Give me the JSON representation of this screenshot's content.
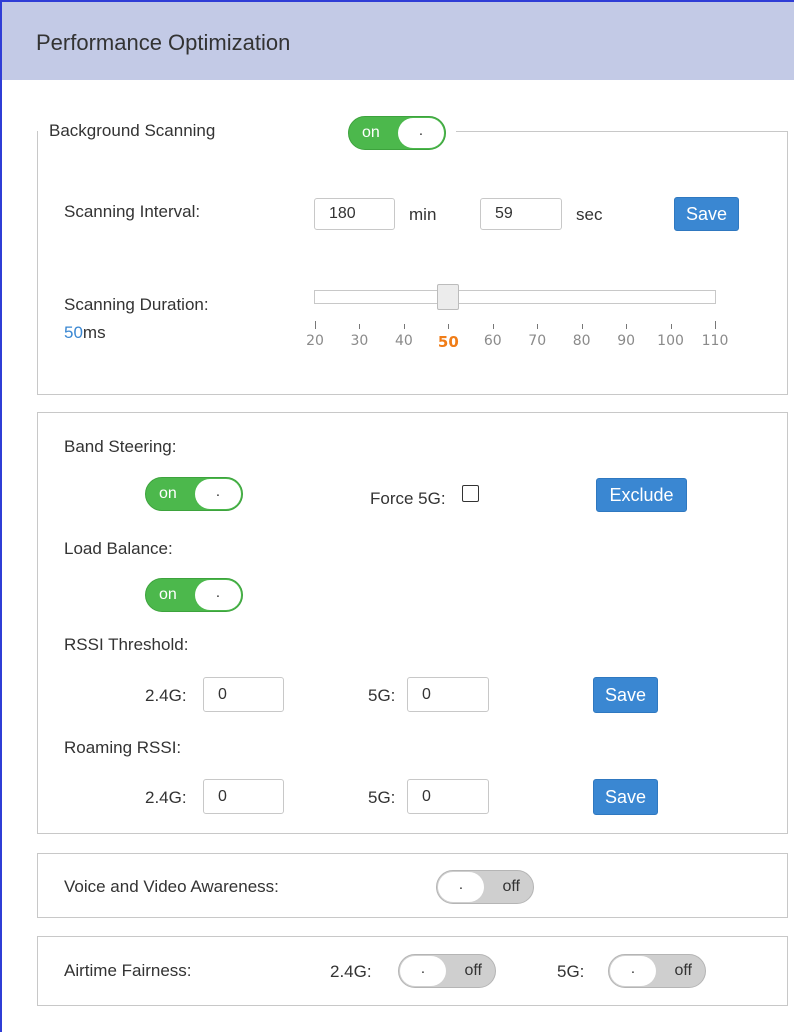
{
  "header": {
    "title": "Performance Optimization"
  },
  "background_scanning": {
    "title": "Background Scanning",
    "toggle": {
      "state_label": "on",
      "knob_label": "."
    },
    "interval_label": "Scanning Interval:",
    "interval_min_value": "180",
    "interval_min_unit": "min",
    "interval_sec_value": "59",
    "interval_sec_unit": "sec",
    "save_label": "Save",
    "duration_label": "Scanning Duration:",
    "duration_value": "50",
    "duration_unit": "ms",
    "slider": {
      "ticks": [
        "20",
        "30",
        "40",
        "50",
        "60",
        "70",
        "80",
        "90",
        "100",
        "110"
      ],
      "min": 20,
      "max": 110,
      "value": 50
    }
  },
  "band_steering": {
    "label": "Band Steering:",
    "toggle": {
      "state_label": "on",
      "knob_label": "."
    },
    "force5g_label": "Force 5G:",
    "force5g_checked": false,
    "exclude_label": "Exclude",
    "load_balance_label": "Load Balance:",
    "load_balance_toggle": {
      "state_label": "on",
      "knob_label": "."
    },
    "rssi_threshold_label": "RSSI Threshold:",
    "rssi_24g_label": "2.4G:",
    "rssi_24g_value": "0",
    "rssi_5g_label": "5G:",
    "rssi_5g_value": "0",
    "rssi_save_label": "Save",
    "roaming_rssi_label": "Roaming RSSI:",
    "roaming_24g_label": "2.4G:",
    "roaming_24g_value": "0",
    "roaming_5g_label": "5G:",
    "roaming_5g_value": "0",
    "roaming_save_label": "Save"
  },
  "voice_video": {
    "label": "Voice and Video Awareness:",
    "toggle": {
      "state_label": "off",
      "knob_label": "."
    }
  },
  "airtime_fairness": {
    "label": "Airtime Fairness:",
    "g24_label": "2.4G:",
    "g24_toggle": {
      "state_label": "off",
      "knob_label": "."
    },
    "g5_label": "5G:",
    "g5_toggle": {
      "state_label": "off",
      "knob_label": "."
    }
  },
  "colors": {
    "header_bg": "#c3cae6",
    "toggle_on": "#4cb84c",
    "toggle_off": "#cfcfcf",
    "button": "#3a87d2",
    "slider_active": "#f07d18",
    "value_blue": "#3a87d2"
  }
}
